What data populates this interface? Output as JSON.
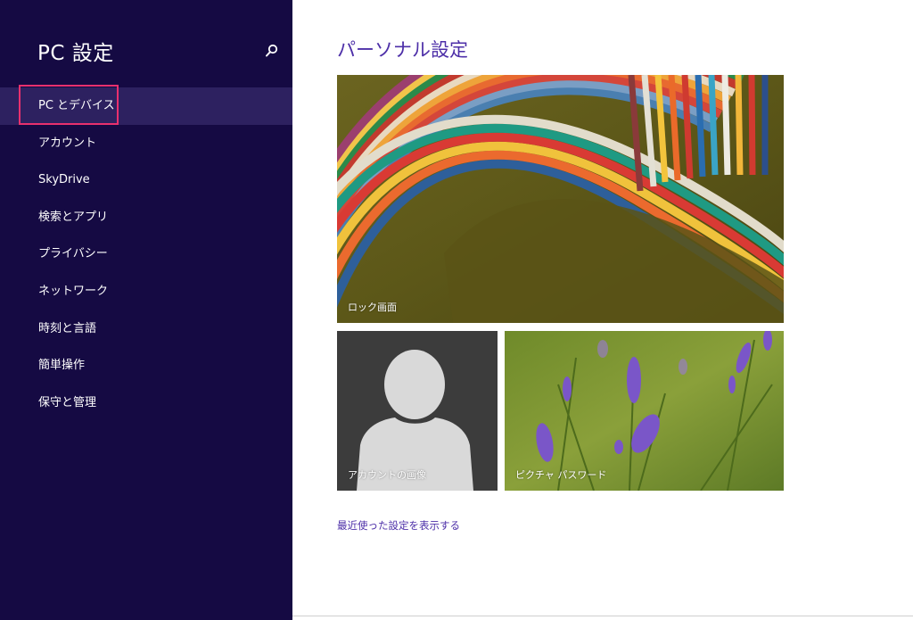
{
  "sidebar": {
    "title": "PC 設定",
    "search_icon": "search-icon",
    "items": [
      {
        "label": "PC とデバイス",
        "selected": true
      },
      {
        "label": "アカウント"
      },
      {
        "label": "SkyDrive"
      },
      {
        "label": "検索とアプリ"
      },
      {
        "label": "プライバシー"
      },
      {
        "label": "ネットワーク"
      },
      {
        "label": "時刻と言語"
      },
      {
        "label": "簡単操作"
      },
      {
        "label": "保守と管理"
      }
    ]
  },
  "main": {
    "title": "パーソナル設定",
    "tiles": {
      "lock": "ロック画面",
      "account": "アカウントの画像",
      "picture": "ピクチャ パスワード"
    },
    "recent_link": "最近使った設定を表示する"
  },
  "colors": {
    "sidebar_bg": "#150a43",
    "selected_bg": "#2d2160",
    "accent": "#4d2fa8",
    "highlight": "#e8306e"
  }
}
